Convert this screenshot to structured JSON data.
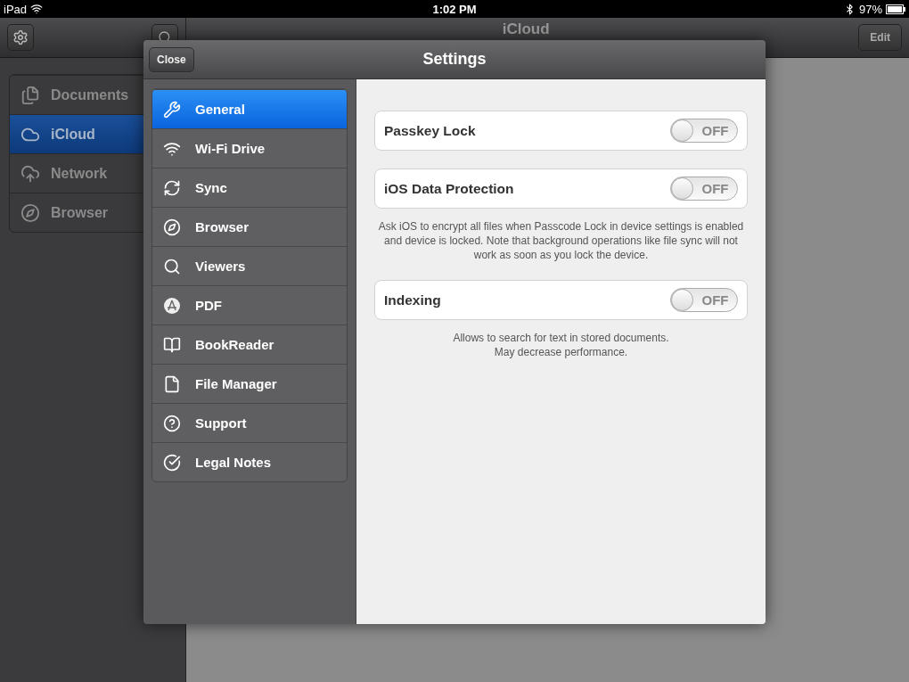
{
  "status_bar": {
    "device": "iPad",
    "time": "1:02 PM",
    "battery": "97%"
  },
  "background_app": {
    "title": "iCloud",
    "edit_button": "Edit",
    "sidebar": {
      "items": [
        {
          "label": "Documents",
          "selected": false
        },
        {
          "label": "iCloud",
          "selected": true
        },
        {
          "label": "Network",
          "selected": false
        },
        {
          "label": "Browser",
          "selected": false
        }
      ]
    }
  },
  "settings": {
    "title": "Settings",
    "close_button": "Close",
    "menu": [
      {
        "label": "General",
        "selected": true
      },
      {
        "label": "Wi-Fi Drive",
        "selected": false
      },
      {
        "label": "Sync",
        "selected": false
      },
      {
        "label": "Browser",
        "selected": false
      },
      {
        "label": "Viewers",
        "selected": false
      },
      {
        "label": "PDF",
        "selected": false
      },
      {
        "label": "BookReader",
        "selected": false
      },
      {
        "label": "File Manager",
        "selected": false
      },
      {
        "label": "Support",
        "selected": false
      },
      {
        "label": "Legal Notes",
        "selected": false
      }
    ],
    "options": [
      {
        "label": "Passkey Lock",
        "on": false,
        "switch_text": "OFF"
      },
      {
        "label": "iOS Data Protection",
        "on": false,
        "switch_text": "OFF",
        "note": "Ask iOS to encrypt all files when Passcode Lock in device settings is enabled and device is locked. Note that background operations like file sync will not work as soon as you lock the device."
      },
      {
        "label": "Indexing",
        "on": false,
        "switch_text": "OFF",
        "note": "Allows to search for text in stored documents.\nMay decrease performance."
      }
    ]
  }
}
